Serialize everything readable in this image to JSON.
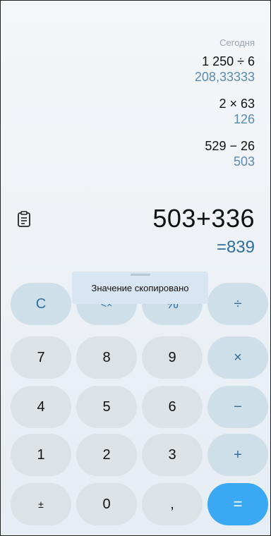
{
  "history": {
    "day_label": "Сегодня",
    "entries": [
      {
        "expression": "1 250 ÷ 6",
        "result": "208,33333"
      },
      {
        "expression": "2 × 63",
        "result": "126"
      },
      {
        "expression": "529 − 26",
        "result": "503"
      }
    ]
  },
  "display": {
    "expression": "503+336",
    "result": "=839"
  },
  "toast": {
    "message": "Значение скопировано"
  },
  "icons": {
    "clipboard": "clipboard-icon",
    "backspace": "backspace-icon"
  },
  "keypad": {
    "clear": "C",
    "backspace": "<×",
    "percent": "%",
    "divide": "÷",
    "seven": "7",
    "eight": "8",
    "nine": "9",
    "multiply": "×",
    "four": "4",
    "five": "5",
    "six": "6",
    "minus": "−",
    "one": "1",
    "two": "2",
    "three": "3",
    "plus": "+",
    "plus_minus": "±",
    "zero": "0",
    "decimal": ",",
    "equals": "="
  },
  "colors": {
    "accent": "#3aa8f2",
    "operator_text": "#2e6f9f",
    "history_result": "#5a8bb0",
    "number_key": "#dde2e7",
    "function_key": "#cfdfea"
  }
}
